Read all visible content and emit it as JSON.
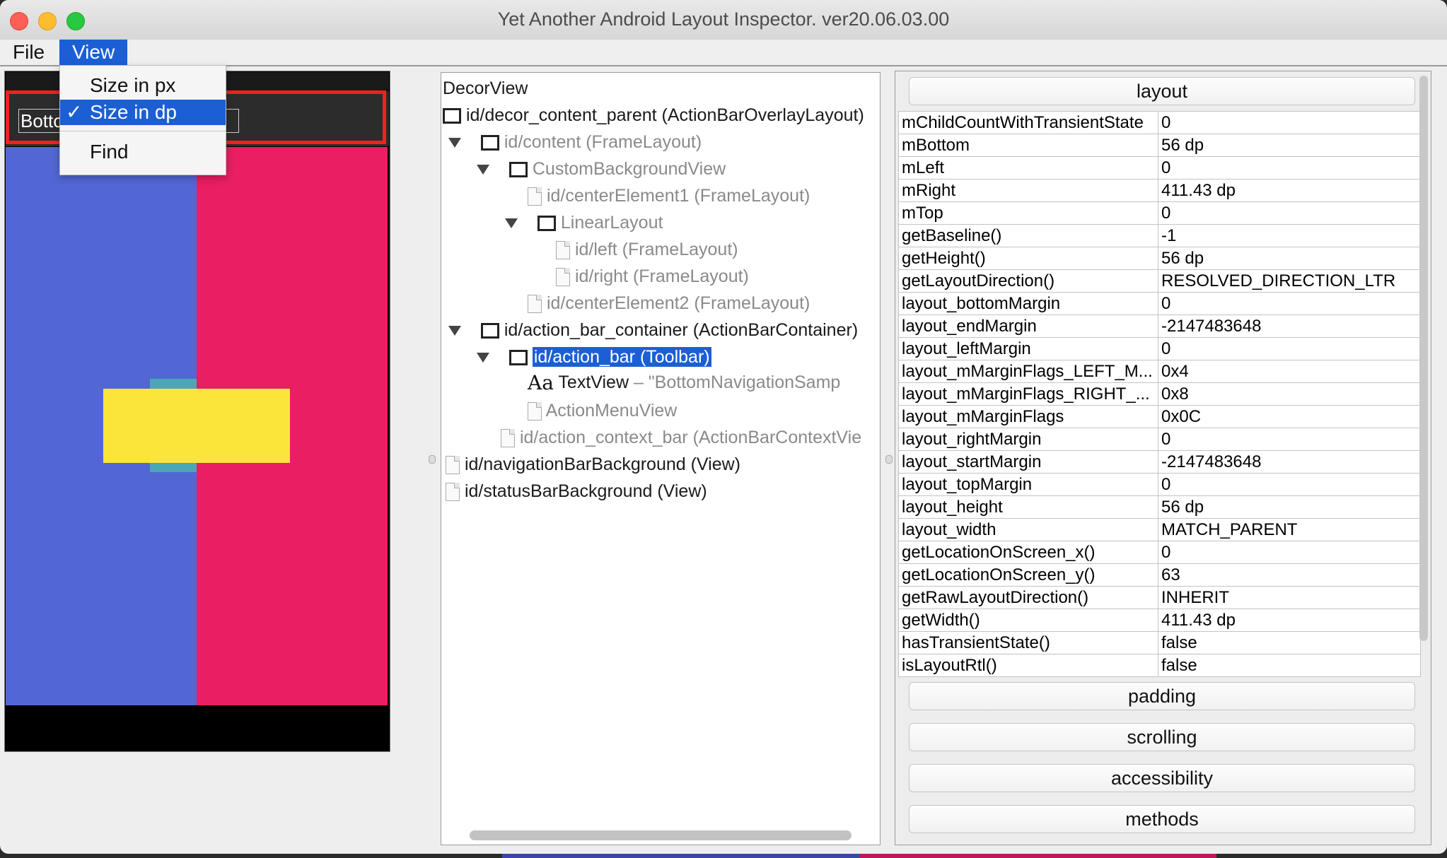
{
  "window": {
    "title": "Yet Another Android Layout Inspector. ver20.06.03.00"
  },
  "menubar": {
    "file": "File",
    "view": "View"
  },
  "view_menu": {
    "items": [
      {
        "label": "Size in px",
        "checked": false
      },
      {
        "label": "Size in dp",
        "checked": true
      },
      {
        "label": "Find",
        "checked": false
      }
    ],
    "check_glyph": "✓"
  },
  "preview": {
    "toolbar_text": "Botto                              e",
    "colors": {
      "left": "#5267d4",
      "right": "#e91e63",
      "center": "#fce53b",
      "center_back": "#4aa8b4",
      "selection": "#ee2222"
    }
  },
  "tree": {
    "rows": [
      {
        "label": "DecorView",
        "icon": "none",
        "expanded": false,
        "dim": false
      },
      {
        "label": "id/decor_content_parent (ActionBarOverlayLayout)",
        "icon": "box-icon",
        "expanded": false,
        "dim": false
      },
      {
        "label": "id/content (FrameLayout)",
        "icon": "box-icon",
        "expanded": true,
        "dim": true
      },
      {
        "label": "CustomBackgroundView",
        "icon": "box-icon",
        "expanded": true,
        "dim": true
      },
      {
        "label": "id/centerElement1 (FrameLayout)",
        "icon": "file-icon",
        "expanded": false,
        "dim": true
      },
      {
        "label": "LinearLayout",
        "icon": "box-icon",
        "expanded": true,
        "dim": true
      },
      {
        "label": "id/left (FrameLayout)",
        "icon": "file-icon",
        "expanded": false,
        "dim": true
      },
      {
        "label": "id/right (FrameLayout)",
        "icon": "file-icon",
        "expanded": false,
        "dim": true
      },
      {
        "label": "id/centerElement2 (FrameLayout)",
        "icon": "file-icon",
        "expanded": false,
        "dim": true
      },
      {
        "label": "id/action_bar_container (ActionBarContainer)",
        "icon": "box-icon",
        "expanded": true,
        "dim": false
      },
      {
        "label": "id/action_bar (Toolbar)",
        "icon": "box-icon",
        "expanded": true,
        "dim": false,
        "selected": true
      },
      {
        "label": "TextView",
        "suffix": " – \"BottomNavigationSamp",
        "icon": "text-icon",
        "expanded": false,
        "dim": false
      },
      {
        "label": "ActionMenuView",
        "icon": "file-icon",
        "expanded": false,
        "dim": true
      },
      {
        "label": "id/action_context_bar (ActionBarContextVie",
        "icon": "file-icon",
        "expanded": false,
        "dim": true
      },
      {
        "label": "id/navigationBarBackground (View)",
        "icon": "file-icon",
        "expanded": false,
        "dim": false
      },
      {
        "label": "id/statusBarBackground (View)",
        "icon": "file-icon",
        "expanded": false,
        "dim": false
      }
    ],
    "text_icon_glyph": "Aa"
  },
  "properties": {
    "sections": {
      "layout": "layout",
      "padding": "padding",
      "scrolling": "scrolling",
      "accessibility": "accessibility",
      "methods": "methods"
    },
    "rows": [
      [
        "mChildCountWithTransientState",
        "0"
      ],
      [
        "mBottom",
        "56 dp"
      ],
      [
        "mLeft",
        "0"
      ],
      [
        "mRight",
        "411.43 dp"
      ],
      [
        "mTop",
        "0"
      ],
      [
        "getBaseline()",
        "-1"
      ],
      [
        "getHeight()",
        "56 dp"
      ],
      [
        "getLayoutDirection()",
        "RESOLVED_DIRECTION_LTR"
      ],
      [
        "layout_bottomMargin",
        "0"
      ],
      [
        "layout_endMargin",
        "-2147483648"
      ],
      [
        "layout_leftMargin",
        "0"
      ],
      [
        "layout_mMarginFlags_LEFT_M...",
        "0x4"
      ],
      [
        "layout_mMarginFlags_RIGHT_...",
        "0x8"
      ],
      [
        "layout_mMarginFlags",
        "0x0C"
      ],
      [
        "layout_rightMargin",
        "0"
      ],
      [
        "layout_startMargin",
        "-2147483648"
      ],
      [
        "layout_topMargin",
        "0"
      ],
      [
        "layout_height",
        "56 dp"
      ],
      [
        "layout_width",
        "MATCH_PARENT"
      ],
      [
        "getLocationOnScreen_x()",
        "0"
      ],
      [
        "getLocationOnScreen_y()",
        "63"
      ],
      [
        "getRawLayoutDirection()",
        "INHERIT"
      ],
      [
        "getWidth()",
        "411.43 dp"
      ],
      [
        "hasTransientState()",
        "false"
      ],
      [
        "isLayoutRtl()",
        "false"
      ]
    ]
  }
}
